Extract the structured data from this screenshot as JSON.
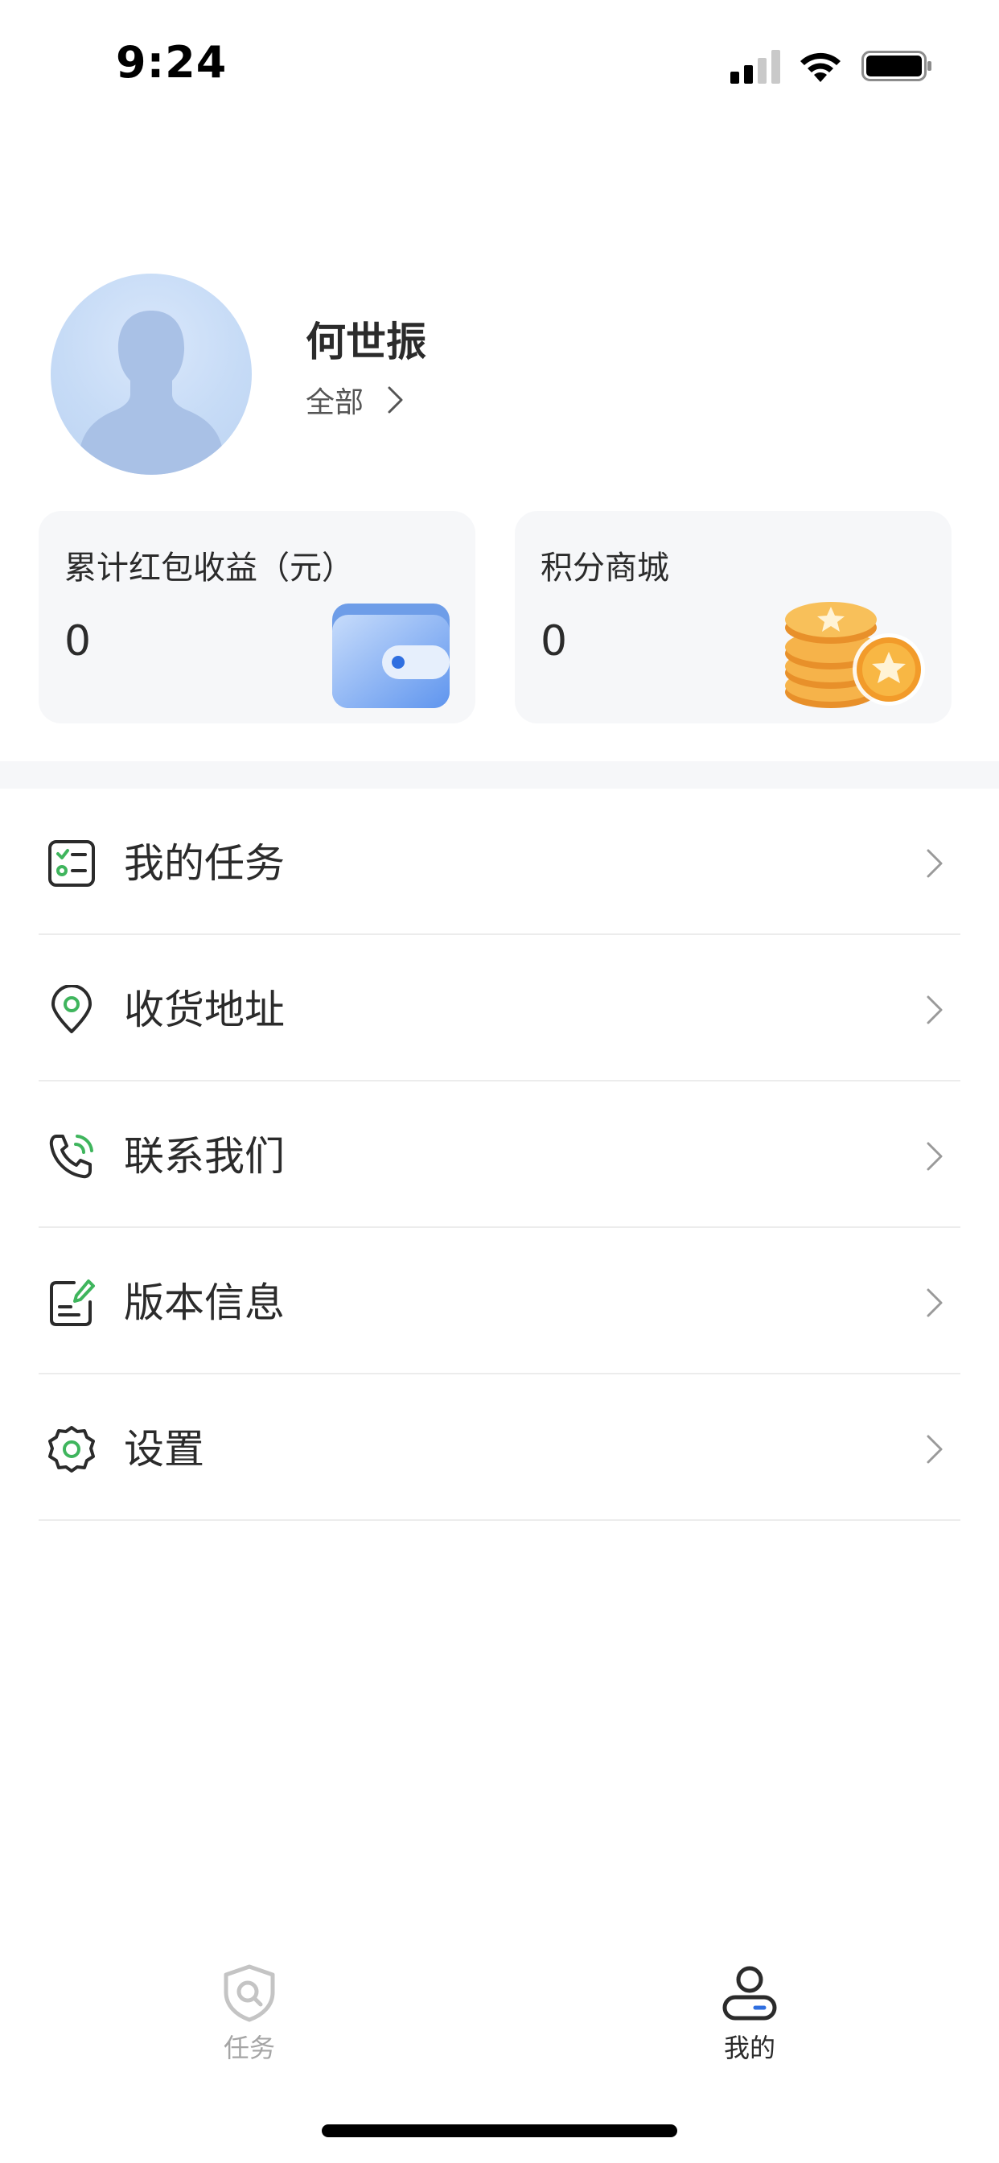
{
  "status_bar": {
    "time": "9:24"
  },
  "profile": {
    "name": "何世振",
    "filter_label": "全部"
  },
  "cards": {
    "red_packet": {
      "title": "累计红包收益（元）",
      "value": "0"
    },
    "points_mall": {
      "title": "积分商城",
      "value": "0"
    }
  },
  "menu": [
    {
      "label": "我的任务",
      "icon": "task-list-icon"
    },
    {
      "label": "收货地址",
      "icon": "location-pin-icon"
    },
    {
      "label": "联系我们",
      "icon": "phone-icon"
    },
    {
      "label": "版本信息",
      "icon": "document-edit-icon"
    },
    {
      "label": "设置",
      "icon": "gear-icon"
    }
  ],
  "tab_bar": {
    "tasks": {
      "label": "任务",
      "active": false
    },
    "mine": {
      "label": "我的",
      "active": true
    }
  },
  "colors": {
    "accent_green": "#3fb55d",
    "accent_blue": "#2f6fe0",
    "coin_orange": "#f3a431"
  }
}
